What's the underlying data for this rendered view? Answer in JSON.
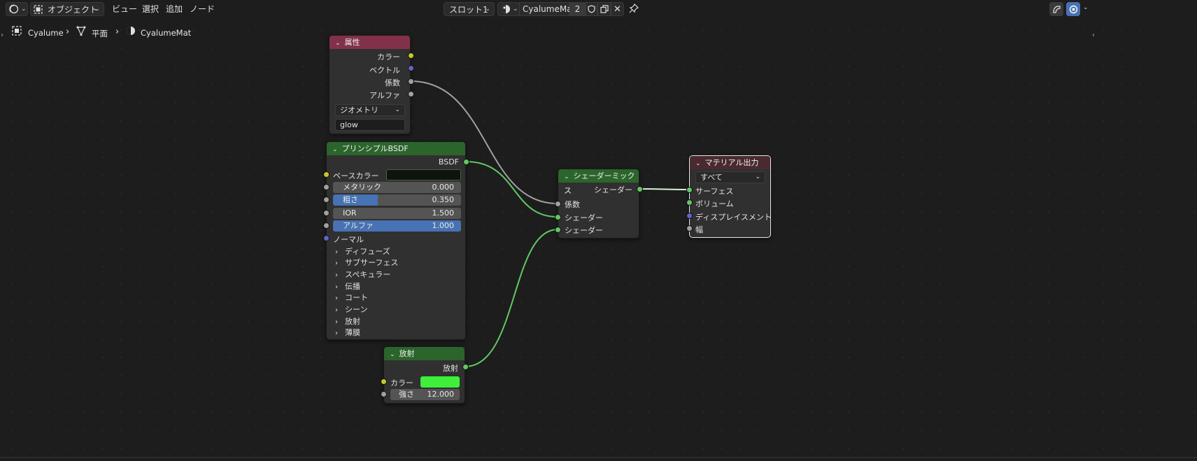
{
  "header": {
    "mode_label": "オブジェクト",
    "menus": [
      "ビュー",
      "選択",
      "追加",
      "ノード"
    ],
    "slot_label": "スロット1",
    "material_name": "CyalumeMat",
    "user_count": "2"
  },
  "breadcrumb": {
    "object": "Cyalume",
    "mesh": "平面",
    "material": "CyalumeMat"
  },
  "nodes": {
    "attribute": {
      "title": "属性",
      "outputs": [
        "カラー",
        "ベクトル",
        "係数",
        "アルファ"
      ],
      "type_value": "ジオメトリ",
      "name_value": "glow"
    },
    "principled": {
      "title": "プリンシプルBSDF",
      "output": "BSDF",
      "base_color_label": "ベースカラー",
      "base_color": "#0b150b",
      "metallic": {
        "label": "メタリック",
        "value": "0.000",
        "fraction": 0
      },
      "roughness": {
        "label": "粗さ",
        "value": "0.350",
        "fraction": 0.35
      },
      "ior": {
        "label": "IOR",
        "value": "1.500",
        "fraction": 0
      },
      "alpha": {
        "label": "アルファ",
        "value": "1.000",
        "fraction": 1
      },
      "normal_label": "ノーマル",
      "panels": [
        "ディフューズ",
        "サブサーフェス",
        "スペキュラー",
        "伝播",
        "コート",
        "シーン",
        "放射",
        "薄膜"
      ]
    },
    "emission": {
      "title": "放射",
      "output": "放射",
      "color_label": "カラー",
      "color": "#3ef03a",
      "strength": {
        "label": "強さ",
        "value": "12.000"
      }
    },
    "mix": {
      "title": "シェーダーミックス",
      "output": "シェーダー",
      "inputs": [
        "係数",
        "シェーダー",
        "シェーダー"
      ]
    },
    "output": {
      "title": "マテリアル出力",
      "target": "すべて",
      "inputs": [
        "サーフェス",
        "ボリューム",
        "ディスプレイスメント",
        "幅"
      ]
    }
  },
  "colors": {
    "attribute_header": "#83314a",
    "shader_header": "#2b652b",
    "output_header": "#4a2a30",
    "socket_shader": "#63c763",
    "wire_gray": "#a1a1a1",
    "accent": "#4772b3"
  }
}
